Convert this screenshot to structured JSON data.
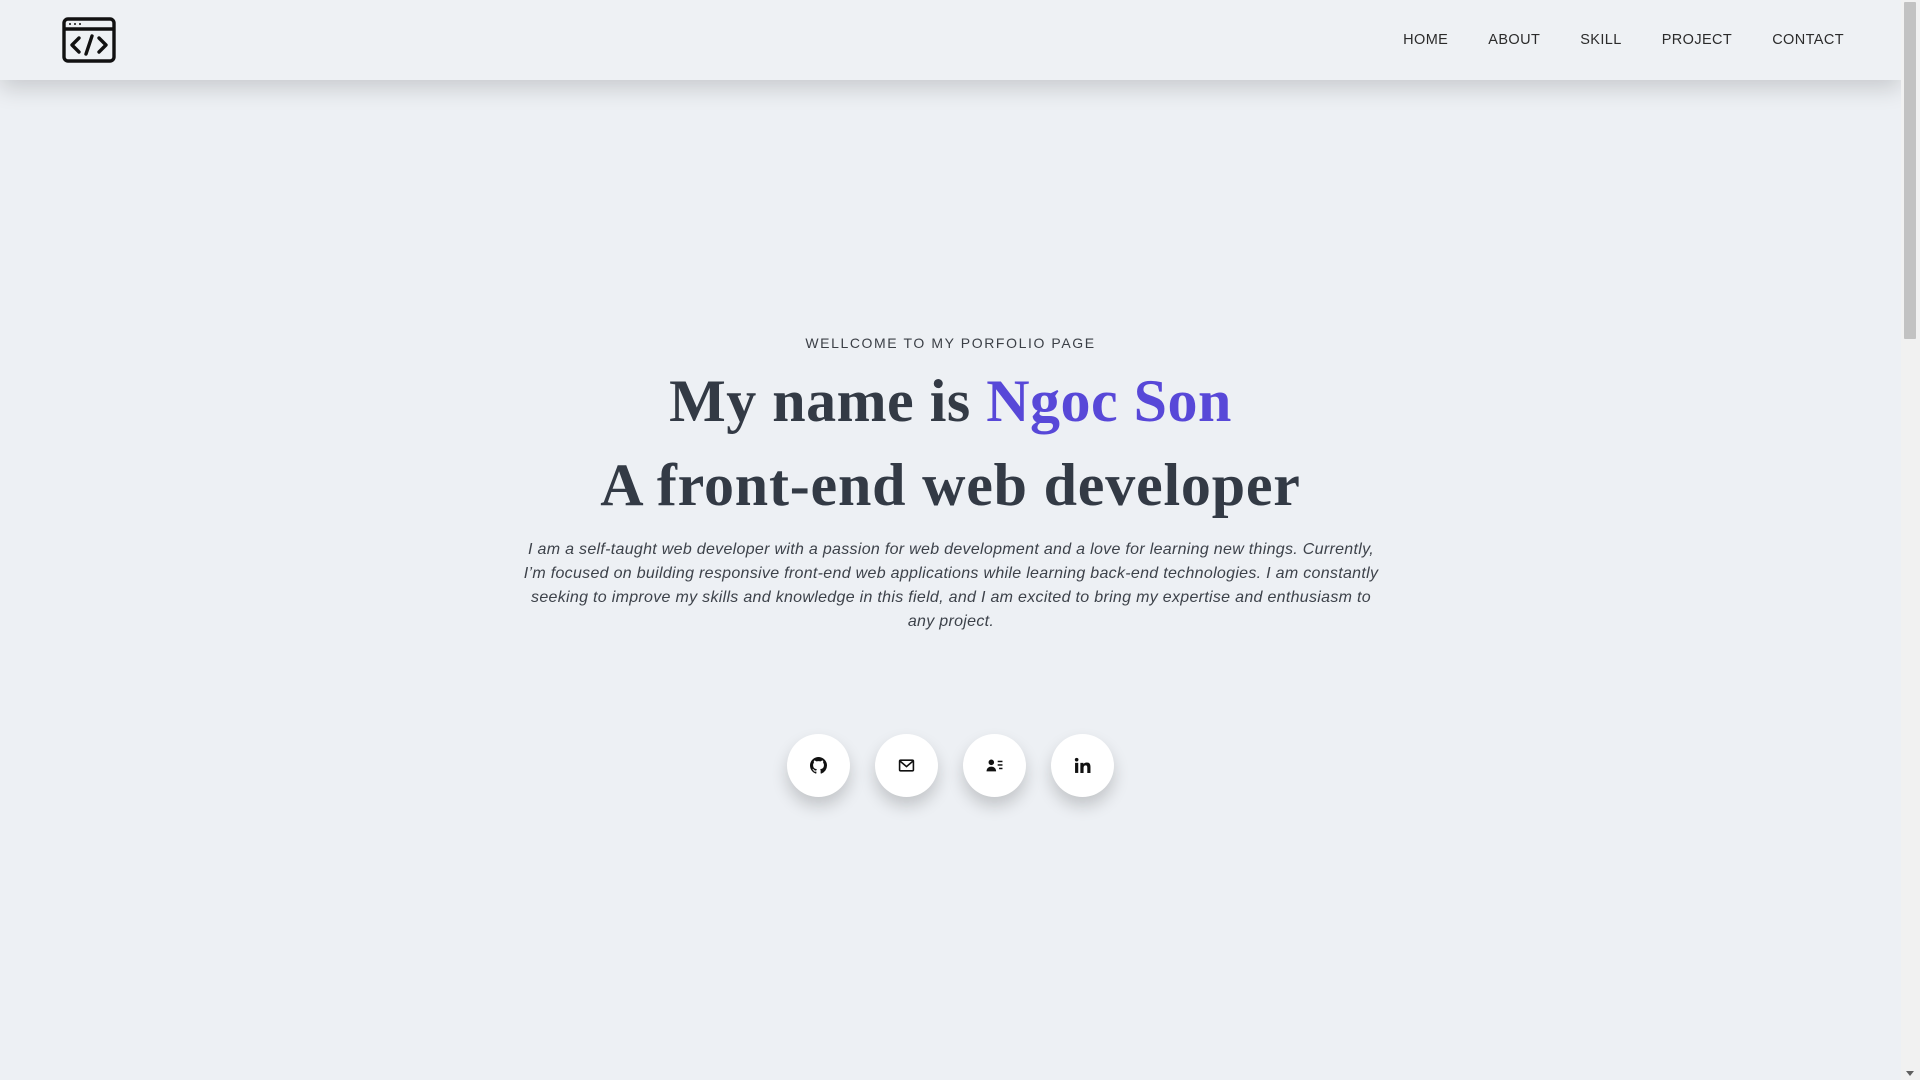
{
  "header": {
    "logo_icon": "code-window-icon",
    "nav": [
      {
        "label": "HOME"
      },
      {
        "label": "ABOUT"
      },
      {
        "label": "SKILL"
      },
      {
        "label": "PROJECT"
      },
      {
        "label": "CONTACT"
      }
    ]
  },
  "hero": {
    "welcome": "WELLCOME TO MY PORFOLIO PAGE",
    "name_prefix": "My name is ",
    "name": "Ngoc Son",
    "role": "A front-end web developer",
    "intro": "I am a self-taught web developer with a passion for web development and a love for learning new things. Currently, I’m focused on building responsive front-end web applications while learning back-end technologies. I am constantly seeking to improve my skills and knowledge in this field, and I am excited to bring my expertise and enthusiasm to any project.",
    "socials": [
      {
        "icon": "github-icon"
      },
      {
        "icon": "mail-icon"
      },
      {
        "icon": "contact-card-icon"
      },
      {
        "icon": "linkedin-icon"
      }
    ]
  },
  "colors": {
    "background": "#edf0f4",
    "accent": "#5848d8",
    "heading": "#333a45"
  }
}
